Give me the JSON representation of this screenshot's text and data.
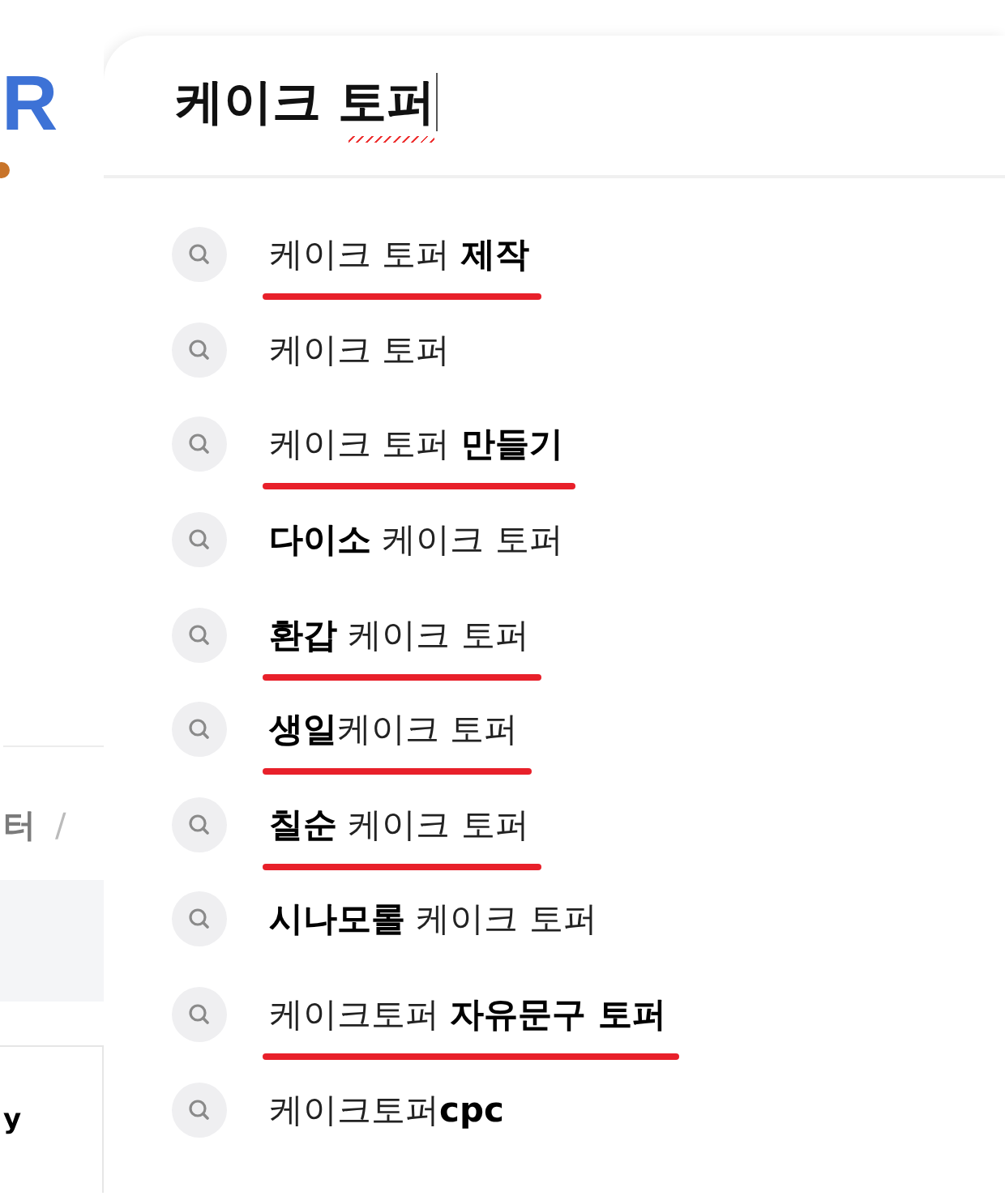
{
  "background_page": {
    "logo": "R",
    "breadcrumb": [
      "터",
      "/"
    ],
    "table_cell": "y"
  },
  "search": {
    "value": "케이크 토퍼",
    "spellcheck_error": true
  },
  "suggestions": [
    {
      "text": "케이크 토퍼 **제작**",
      "underlined": true
    },
    {
      "text": "케이크 토퍼",
      "underlined": false
    },
    {
      "text": "케이크 토퍼 **만들기**",
      "underlined": true
    },
    {
      "text": "**다이소** 케이크 토퍼",
      "underlined": false
    },
    {
      "text": "**환갑** 케이크 토퍼",
      "underlined": true
    },
    {
      "text": "**생일**케이크 토퍼",
      "underlined": true
    },
    {
      "text": "**칠순** 케이크 토퍼",
      "underlined": true
    },
    {
      "text": "**시나모롤** 케이크 토퍼",
      "underlined": false
    },
    {
      "text": "케이크토퍼 **자유문구 토퍼**",
      "underlined": true
    },
    {
      "text": "케이크토퍼**cpc**",
      "underlined": false
    }
  ]
}
